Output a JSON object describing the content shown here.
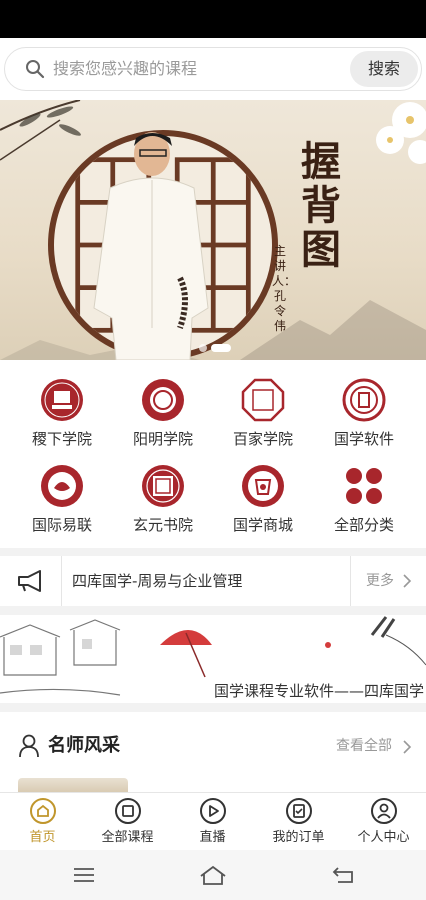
{
  "search": {
    "placeholder": "搜索您感兴趣的课程",
    "button_label": "搜索"
  },
  "banner": {
    "title": "握背图",
    "subtitle": "主讲人：孔令伟",
    "slide_count": 2,
    "active_slide": 2
  },
  "categories": [
    {
      "label": "稷下学院",
      "icon": "jixia-academy-icon"
    },
    {
      "label": "阳明学院",
      "icon": "yangming-academy-icon"
    },
    {
      "label": "百家学院",
      "icon": "baijia-academy-icon"
    },
    {
      "label": "国学软件",
      "icon": "guoxue-software-icon"
    },
    {
      "label": "国际易联",
      "icon": "international-yilian-icon"
    },
    {
      "label": "玄元书院",
      "icon": "xuanyuan-academy-icon"
    },
    {
      "label": "国学商城",
      "icon": "guoxue-mall-icon"
    },
    {
      "label": "全部分类",
      "icon": "all-categories-icon"
    }
  ],
  "notice": {
    "text": "四库国学-周易与企业管理",
    "more_label": "更多"
  },
  "promo": {
    "text": "国学课程专业软件——四库国学"
  },
  "section": {
    "title": "名师风采",
    "more_label": "查看全部"
  },
  "tabs": [
    {
      "label": "首页",
      "icon": "home-icon",
      "active": true
    },
    {
      "label": "全部课程",
      "icon": "courses-icon",
      "active": false
    },
    {
      "label": "直播",
      "icon": "live-icon",
      "active": false
    },
    {
      "label": "我的订单",
      "icon": "orders-icon",
      "active": false
    },
    {
      "label": "个人中心",
      "icon": "profile-icon",
      "active": false
    }
  ],
  "colors": {
    "brand_red": "#a8262c",
    "active_tab": "#c0962c"
  }
}
